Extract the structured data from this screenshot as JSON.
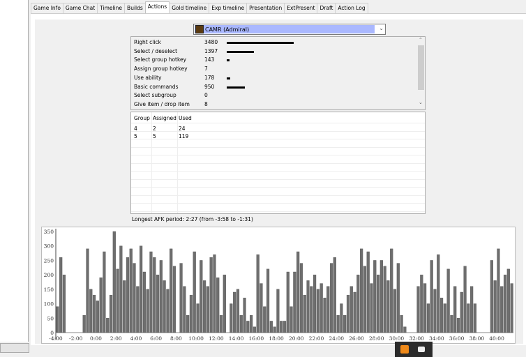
{
  "tabs": [
    "Game Info",
    "Game Chat",
    "Timeline",
    "Builds",
    "Actions",
    "Gold timeline",
    "Exp timeline",
    "Presentation",
    "ExtPresent",
    "Draft",
    "Action Log"
  ],
  "active_tab": "Actions",
  "player_select": {
    "value": "CAMR (Admiral)"
  },
  "actions": [
    {
      "label": "Right click",
      "value": 3480
    },
    {
      "label": "Select / deselect",
      "value": 1397
    },
    {
      "label": "Select group hotkey",
      "value": 143
    },
    {
      "label": "Assign group hotkey",
      "value": 7
    },
    {
      "label": "Use ability",
      "value": 178
    },
    {
      "label": "Basic commands",
      "value": 950
    },
    {
      "label": "Select subgroup",
      "value": 0
    },
    {
      "label": "Give item / drop item",
      "value": 8
    }
  ],
  "groups": {
    "headers": [
      "Group",
      "Assigned",
      "Used"
    ],
    "rows": [
      [
        "4",
        "2",
        "24"
      ],
      [
        "5",
        "5",
        "119"
      ]
    ]
  },
  "afk_text": "Longest AFK period: 2:27 (from -3:58 to -1:31)",
  "chart_data": {
    "type": "bar",
    "xlim": [
      "-4:00",
      "41:40"
    ],
    "ylim": [
      0,
      350
    ],
    "yticks": [
      "0",
      "50",
      "100",
      "150",
      "200",
      "250",
      "300",
      "350"
    ],
    "xticks": [
      "-4:00",
      "-2:00",
      "0:00",
      "2:00",
      "4:00",
      "6:00",
      "8:00",
      "10:00",
      "12:00",
      "14:00",
      "16:00",
      "18:00",
      "20:00",
      "22:00",
      "24:00",
      "26:00",
      "28:00",
      "30:00",
      "32:00",
      "34:00",
      "36:00",
      "38:00",
      "40:00"
    ],
    "bar_color": "#6e6e6e",
    "values": [
      90,
      260,
      200,
      0,
      0,
      0,
      0,
      0,
      60,
      290,
      150,
      130,
      110,
      190,
      280,
      50,
      130,
      350,
      220,
      300,
      180,
      260,
      290,
      240,
      160,
      300,
      210,
      150,
      280,
      260,
      200,
      250,
      180,
      150,
      290,
      230,
      0,
      240,
      160,
      60,
      130,
      280,
      100,
      250,
      180,
      160,
      260,
      270,
      190,
      60,
      200,
      0,
      100,
      140,
      150,
      60,
      120,
      40,
      60,
      20,
      270,
      170,
      90,
      220,
      40,
      20,
      150,
      40,
      40,
      210,
      90,
      210,
      280,
      240,
      130,
      180,
      160,
      200,
      150,
      170,
      120,
      160,
      240,
      260,
      60,
      100,
      60,
      130,
      160,
      140,
      200,
      290,
      230,
      280,
      170,
      250,
      200,
      250,
      230,
      180,
      290,
      150,
      240,
      60,
      20,
      0,
      0,
      0,
      160,
      200,
      170,
      100,
      250,
      150,
      270,
      120,
      100,
      220,
      60,
      160,
      50,
      140,
      230,
      100,
      160,
      100,
      0,
      0,
      0,
      0,
      250,
      180,
      290,
      160,
      200,
      220,
      170
    ]
  }
}
